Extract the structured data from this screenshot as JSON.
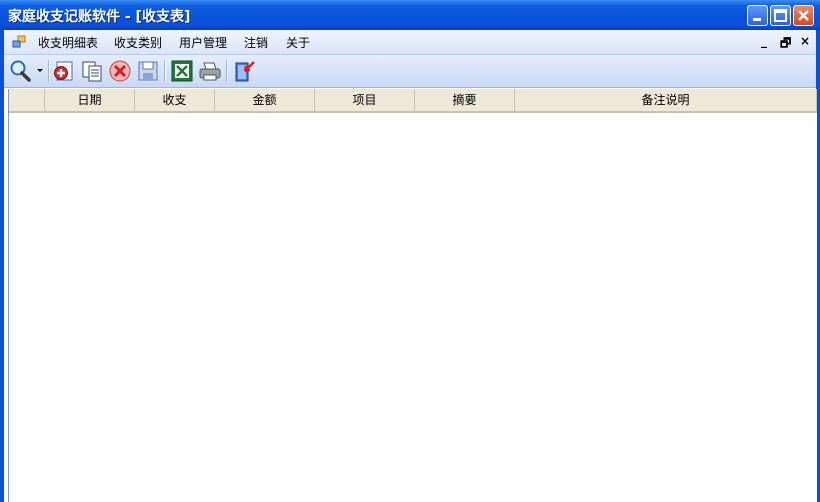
{
  "window": {
    "title": "家庭收支记账软件 - [收支表]"
  },
  "menu": {
    "items": [
      "收支明细表",
      "收支类别",
      "用户管理",
      "注销",
      "关于"
    ],
    "mdi_minimize": "_",
    "mdi_restore": "🗗",
    "mdi_close": "×"
  },
  "toolbar": {
    "tools": [
      "search-icon",
      "add-icon",
      "copy-icon",
      "delete-icon",
      "save-icon",
      "excel-icon",
      "print-icon",
      "exit-icon"
    ]
  },
  "grid": {
    "columns": [
      "",
      "日期",
      "收支",
      "金额",
      "项目",
      "摘要",
      "备注说明"
    ],
    "rows": []
  },
  "colors": {
    "titlebar": "#0a52dc",
    "menubar": "#dbe5f8",
    "header": "#ece9d8"
  }
}
